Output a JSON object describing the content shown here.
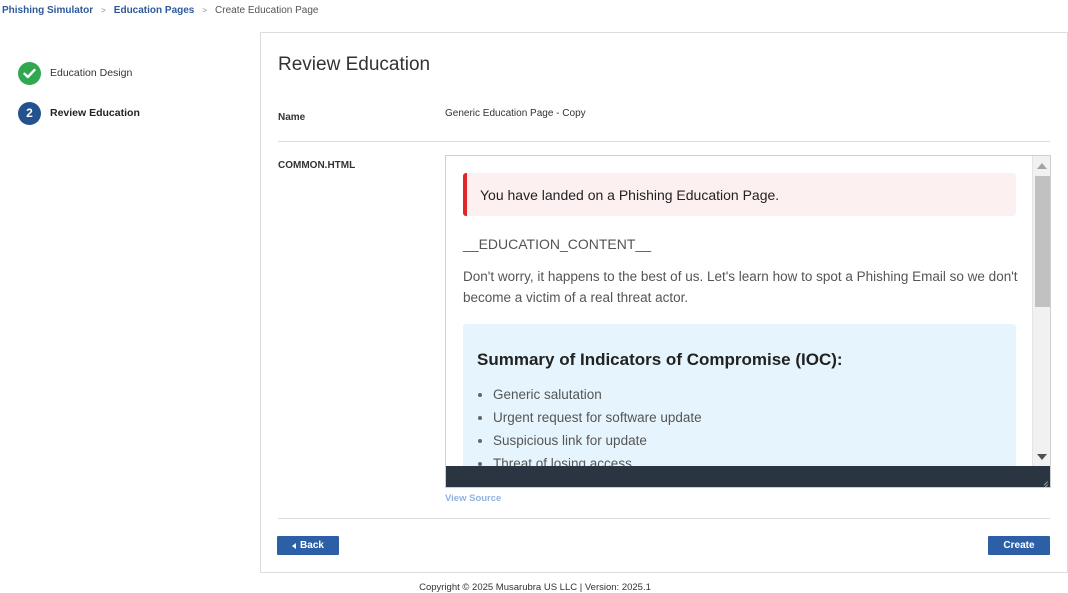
{
  "breadcrumb": {
    "items": [
      "Phishing Simulator",
      "Education Pages"
    ],
    "separator": ">",
    "current": "Create Education Page"
  },
  "steps": [
    {
      "number": "✓",
      "label": "Education Design",
      "status": "done"
    },
    {
      "number": "2",
      "label": "Review Education",
      "status": "active"
    }
  ],
  "review": {
    "title": "Review Education",
    "name_label": "Name",
    "name_value": "Generic Education Page - Copy",
    "html_label": "COMMON.HTML"
  },
  "preview": {
    "alert_text": "You have landed on a Phishing Education Page.",
    "content_placeholder": "__EDUCATION_CONTENT__",
    "intro_text": "Don't worry, it happens to the best of us. Let's learn how to spot a Phishing Email so we don't become a victim of a real threat actor.",
    "ioc_title": "Summary of Indicators of Compromise (IOC):",
    "ioc_items": [
      "Generic salutation",
      "Urgent request for software update",
      "Suspicious link for update",
      "Threat of losing access"
    ]
  },
  "actions": {
    "view_source": "View Source",
    "back": "Back",
    "create": "Create"
  },
  "footer": {
    "text": "Copyright © 2025 Musarubra US LLC | Version: 2025.1"
  },
  "colors": {
    "primary": "#2d5fa6",
    "success": "#2fa84f",
    "active_step": "#23528f",
    "alert_border": "#e0252b",
    "ioc_background": "#e6f5fd"
  }
}
